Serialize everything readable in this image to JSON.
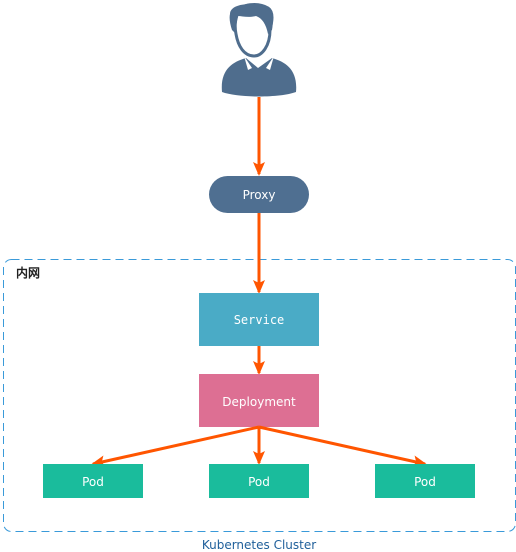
{
  "colors": {
    "user": "#4f6d8d",
    "proxy": "#4f6f91",
    "service": "#4aabc6",
    "deployment": "#dd6f93",
    "pod": "#1abc9c",
    "arrow": "#ff5500",
    "cluster_border": "#3a9ad9"
  },
  "user": {
    "icon": "user-icon"
  },
  "proxy": {
    "label": "Proxy"
  },
  "network": {
    "label": "内网"
  },
  "service": {
    "label": "Service"
  },
  "deployment": {
    "label": "Deployment"
  },
  "pods": [
    {
      "label": "Pod"
    },
    {
      "label": "Pod"
    },
    {
      "label": "Pod"
    }
  ],
  "cluster": {
    "label": "Kubernetes Cluster"
  }
}
